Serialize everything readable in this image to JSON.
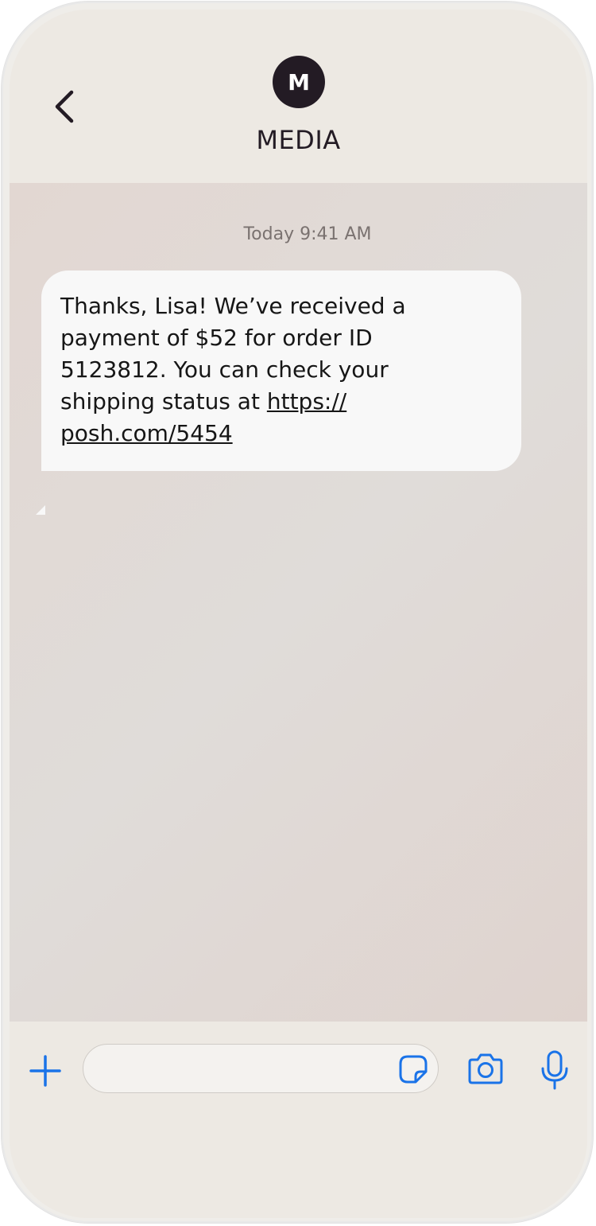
{
  "header": {
    "avatar_letter": "M",
    "contact_name": "MEDIA",
    "back_icon": "chevron-left-icon"
  },
  "conversation": {
    "timestamp": "Today 9:41 AM",
    "messages": [
      {
        "direction": "incoming",
        "lines": [
          "Thanks, Lisa! We’ve received a",
          "payment of $52 for order ID",
          "5123812. You can check your",
          "shipping status at "
        ],
        "link_part1": "https://",
        "link_part2": "posh.com/5454"
      }
    ]
  },
  "composer": {
    "input_value": "",
    "icons": {
      "add": "plus-icon",
      "sticker": "sticker-icon",
      "camera": "camera-icon",
      "microphone": "microphone-icon"
    }
  },
  "colors": {
    "accent": "#1a73e8",
    "avatar_bg": "#231b24",
    "bubble_bg": "#f8f8f8",
    "frame_bg": "#ede9e3"
  }
}
